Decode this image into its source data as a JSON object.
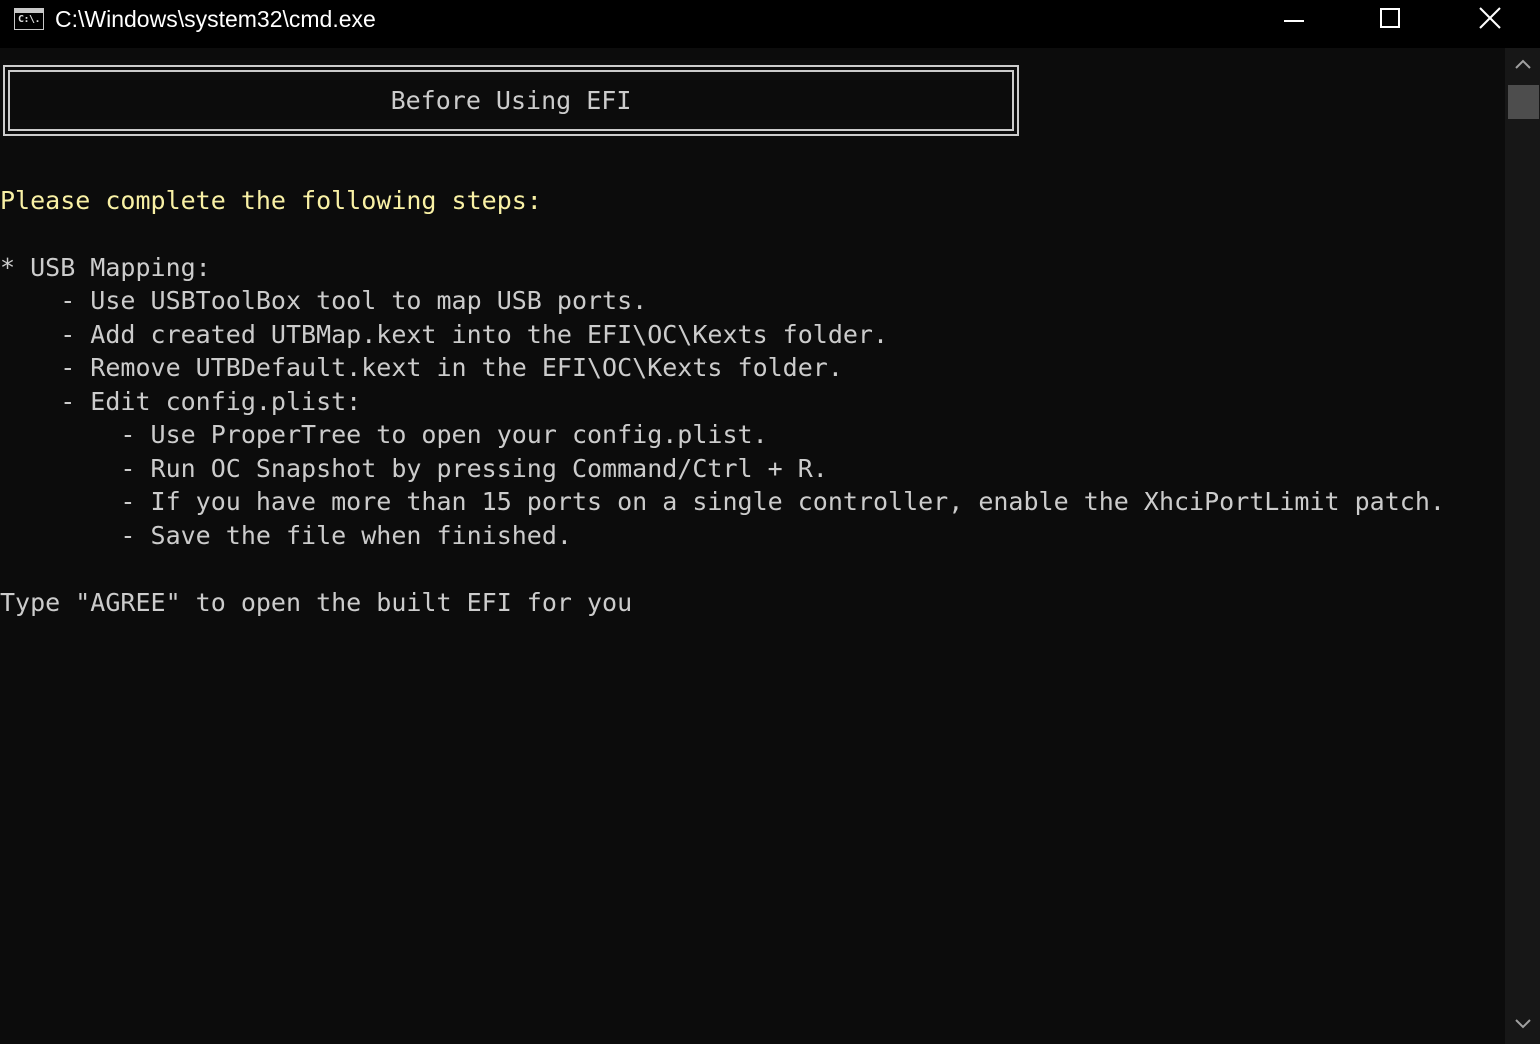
{
  "window": {
    "title": "C:\\Windows\\system32\\cmd.exe",
    "icon": "cmd-console-icon",
    "icon_text": "C:\\."
  },
  "controls": {
    "minimize_icon": "minimize-icon",
    "maximize_icon": "maximize-icon",
    "close_icon": "close-icon"
  },
  "console": {
    "banner": "Before Using EFI",
    "heading": "Please complete the following steps:",
    "lines": [
      "* USB Mapping:",
      "    - Use USBToolBox tool to map USB ports.",
      "    - Add created UTBMap.kext into the EFI\\OC\\Kexts folder.",
      "    - Remove UTBDefault.kext in the EFI\\OC\\Kexts folder.",
      "    - Edit config.plist:",
      "        - Use ProperTree to open your config.plist.",
      "        - Run OC Snapshot by pressing Command/Ctrl + R.",
      "        - If you have more than 15 ports on a single controller, enable the XhciPortLimit patch.",
      "        - Save the file when finished."
    ],
    "prompt": "Type \"AGREE\" to open the built EFI for you"
  },
  "colors": {
    "background": "#0c0c0c",
    "text": "#cccccc",
    "heading_text": "#f9f1a5",
    "titlebar": "#000000"
  }
}
